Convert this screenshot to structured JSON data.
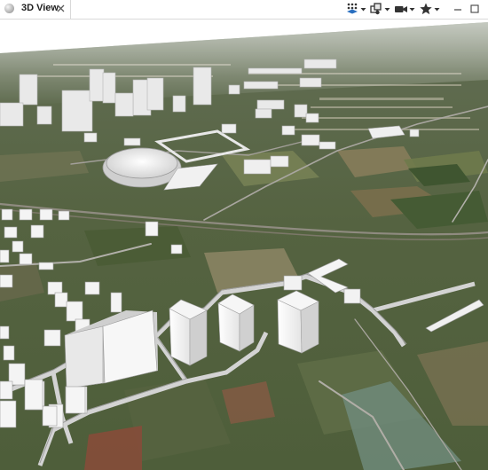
{
  "tab": {
    "title": "3D View",
    "icon": "globe-icon",
    "close_icon": "close-icon"
  },
  "toolbar": {
    "tools": [
      {
        "name": "layers-icon"
      },
      {
        "name": "camera-nav-icon"
      },
      {
        "name": "video-camera-icon"
      },
      {
        "name": "star-icon"
      }
    ],
    "window_buttons": [
      {
        "name": "minimize-icon"
      },
      {
        "name": "maximize-icon"
      }
    ]
  },
  "colors": {
    "tab_bg": "#ffffff",
    "sky": "#ffffff",
    "terrain": "#5b6a45",
    "buildings": "#f2f2f2"
  }
}
